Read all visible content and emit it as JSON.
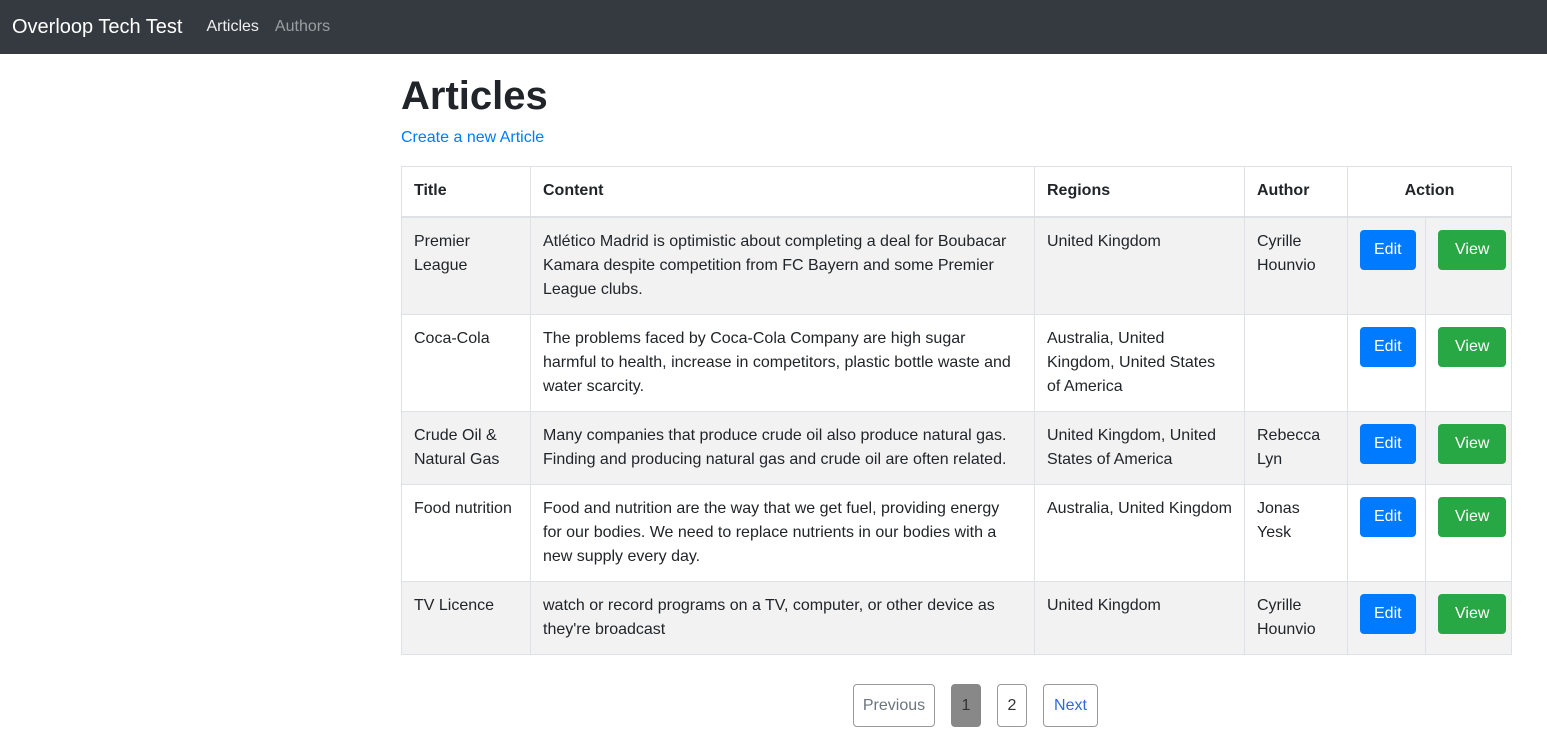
{
  "navbar": {
    "brand": "Overloop Tech Test",
    "links": [
      {
        "label": "Articles",
        "active": true
      },
      {
        "label": "Authors",
        "active": false
      }
    ]
  },
  "page": {
    "title": "Articles",
    "create_link": "Create a new Article"
  },
  "table": {
    "headers": {
      "title": "Title",
      "content": "Content",
      "regions": "Regions",
      "author": "Author",
      "action": "Action"
    },
    "rows": [
      {
        "title": "Premier League",
        "content": "Atlético Madrid is optimistic about completing a deal for Boubacar Kamara despite competition from FC Bayern and some Premier League clubs.",
        "regions": "United Kingdom",
        "author": "Cyrille Hounvio"
      },
      {
        "title": "Coca-Cola",
        "content": "The problems faced by Coca-Cola Company are high sugar harmful to health, increase in competitors, plastic bottle waste and water scarcity.",
        "regions": "Australia, United Kingdom, United States of America",
        "author": ""
      },
      {
        "title": "Crude Oil & Natural Gas",
        "content": "Many companies that produce crude oil also produce natural gas. Finding and producing natural gas and crude oil are often related.",
        "regions": "United Kingdom, United States of America",
        "author": "Rebecca Lyn"
      },
      {
        "title": "Food nutrition",
        "content": "Food and nutrition are the way that we get fuel, providing energy for our bodies. We need to replace nutrients in our bodies with a new supply every day.",
        "regions": "Australia, United Kingdom",
        "author": "Jonas Yesk"
      },
      {
        "title": "TV Licence",
        "content": "watch or record programs on a TV, computer, or other device as they're broadcast",
        "regions": "United Kingdom",
        "author": "Cyrille Hounvio"
      }
    ],
    "edit_label": "Edit",
    "view_label": "View"
  },
  "pagination": {
    "previous": "Previous",
    "pages": [
      "1",
      "2"
    ],
    "current": "1",
    "next": "Next"
  },
  "colors": {
    "navbar_bg": "#343a40",
    "link": "#007bff",
    "edit_button": "#007bff",
    "view_button": "#28a745",
    "striped_row": "#f2f2f2"
  }
}
